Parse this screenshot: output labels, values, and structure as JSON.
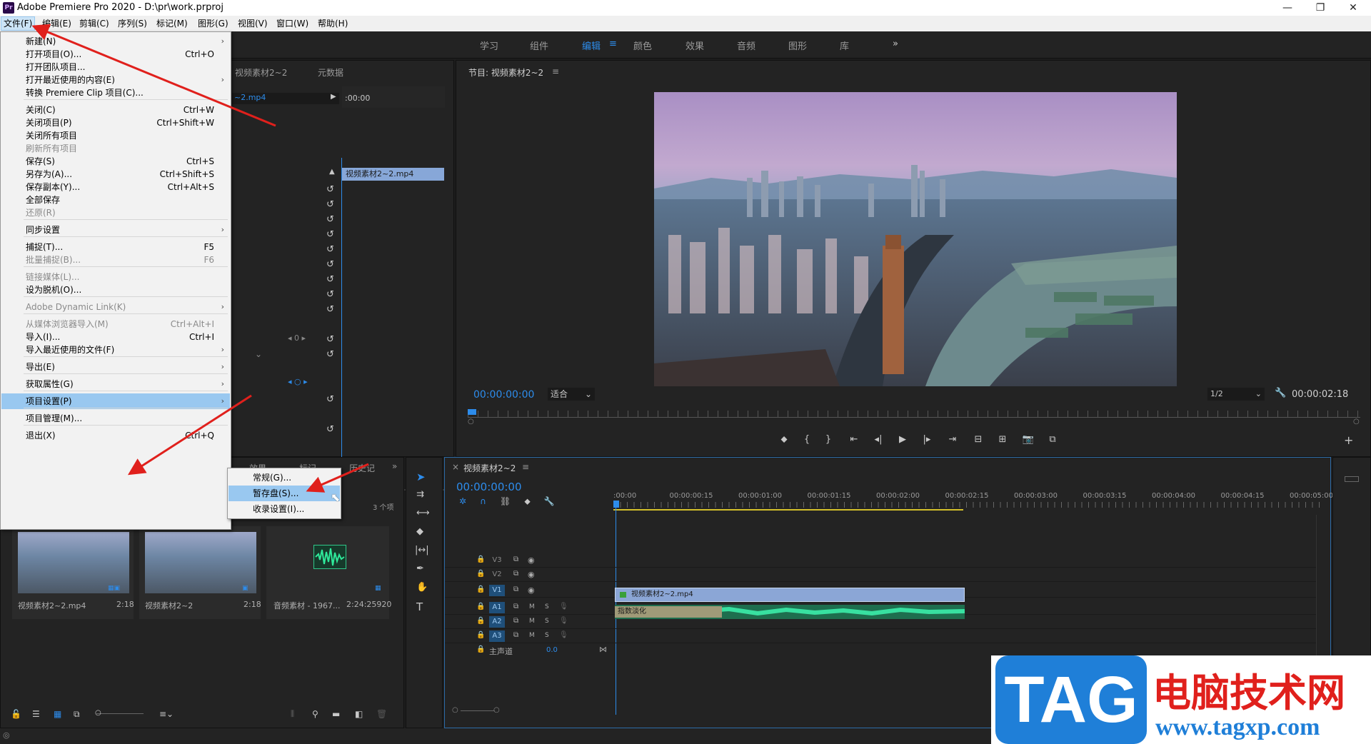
{
  "titlebar": {
    "title": "Adobe Premiere Pro 2020 - D:\\pr\\work.prproj",
    "logo": "Pr",
    "minimize": "—",
    "restore": "❐",
    "close": "✕"
  },
  "menubar": [
    "文件(F)",
    "编辑(E)",
    "剪辑(C)",
    "序列(S)",
    "标记(M)",
    "图形(G)",
    "视图(V)",
    "窗口(W)",
    "帮助(H)"
  ],
  "workspaces": {
    "items": [
      "学习",
      "组件",
      "编辑",
      "颜色",
      "效果",
      "音频",
      "图形",
      "库"
    ],
    "more": "»",
    "active_color": "#2d8ceb"
  },
  "source_panel": {
    "tabs": [
      "视频素材2~2",
      "元数据"
    ],
    "clip_tab": "~2.mp4",
    "ruler_time": ":00:00",
    "clip_label": "视频素材2~2.mp4",
    "kf_value": "0"
  },
  "program_monitor": {
    "title": "节目: 视频素材2~2",
    "menu": "≡",
    "timecode_left": "00:00:00:00",
    "fit": "适合",
    "resolution": "1/2",
    "timecode_right": "00:00:02:18",
    "plus": "+"
  },
  "project_panel": {
    "tabs": [
      "效果",
      "标记",
      "历史记"
    ],
    "count": "3 个项",
    "items": [
      {
        "name": "视频素材2~2.mp4",
        "duration": "2:18"
      },
      {
        "name": "视频素材2~2",
        "duration": "2:18"
      },
      {
        "name": "音频素材 - 1967...",
        "duration": "2:24:25920"
      }
    ]
  },
  "timeline": {
    "title": "视频素材2~2",
    "timecode": "00:00:00:00",
    "ruler": [
      ":00:00",
      "00:00:00:15",
      "00:00:01:00",
      "00:00:01:15",
      "00:00:02:00",
      "00:00:02:15",
      "00:00:03:00",
      "00:00:03:15",
      "00:00:04:00",
      "00:00:04:15",
      "00:00:05:00"
    ],
    "tracks": [
      "V3",
      "V2",
      "V1",
      "A1",
      "A2",
      "A3"
    ],
    "master": "主声道",
    "master_value": "0.0",
    "video_clip": "视频素材2~2.mp4",
    "audio_effect": "指数淡化",
    "m": "M",
    "s": "S"
  },
  "file_menu": {
    "items": [
      {
        "label": "新建(N)",
        "shortcut": "",
        "arrow": "›",
        "disabled": false
      },
      {
        "label": "打开项目(O)...",
        "shortcut": "Ctrl+O",
        "arrow": "",
        "disabled": false
      },
      {
        "label": "打开团队项目...",
        "shortcut": "",
        "arrow": "",
        "disabled": false
      },
      {
        "label": "打开最近使用的内容(E)",
        "shortcut": "",
        "arrow": "›",
        "disabled": false
      },
      {
        "label": "转换 Premiere Clip 项目(C)...",
        "shortcut": "",
        "arrow": "",
        "disabled": false
      },
      {
        "label": "关闭(C)",
        "shortcut": "Ctrl+W",
        "arrow": "",
        "disabled": false
      },
      {
        "label": "关闭项目(P)",
        "shortcut": "Ctrl+Shift+W",
        "arrow": "",
        "disabled": false
      },
      {
        "label": "关闭所有项目",
        "shortcut": "",
        "arrow": "",
        "disabled": false
      },
      {
        "label": "刷新所有项目",
        "shortcut": "",
        "arrow": "",
        "disabled": true
      },
      {
        "label": "保存(S)",
        "shortcut": "Ctrl+S",
        "arrow": "",
        "disabled": false
      },
      {
        "label": "另存为(A)...",
        "shortcut": "Ctrl+Shift+S",
        "arrow": "",
        "disabled": false
      },
      {
        "label": "保存副本(Y)...",
        "shortcut": "Ctrl+Alt+S",
        "arrow": "",
        "disabled": false
      },
      {
        "label": "全部保存",
        "shortcut": "",
        "arrow": "",
        "disabled": false
      },
      {
        "label": "还原(R)",
        "shortcut": "",
        "arrow": "",
        "disabled": true
      },
      {
        "label": "同步设置",
        "shortcut": "",
        "arrow": "›",
        "disabled": false
      },
      {
        "label": "捕捉(T)...",
        "shortcut": "F5",
        "arrow": "",
        "disabled": false
      },
      {
        "label": "批量捕捉(B)...",
        "shortcut": "F6",
        "arrow": "",
        "disabled": true
      },
      {
        "label": "链接媒体(L)...",
        "shortcut": "",
        "arrow": "",
        "disabled": true
      },
      {
        "label": "设为脱机(O)...",
        "shortcut": "",
        "arrow": "",
        "disabled": false
      },
      {
        "label": "Adobe Dynamic Link(K)",
        "shortcut": "",
        "arrow": "›",
        "disabled": true
      },
      {
        "label": "从媒体浏览器导入(M)",
        "shortcut": "Ctrl+Alt+I",
        "arrow": "",
        "disabled": true
      },
      {
        "label": "导入(I)...",
        "shortcut": "Ctrl+I",
        "arrow": "",
        "disabled": false
      },
      {
        "label": "导入最近使用的文件(F)",
        "shortcut": "",
        "arrow": "›",
        "disabled": false
      },
      {
        "label": "导出(E)",
        "shortcut": "",
        "arrow": "›",
        "disabled": false
      },
      {
        "label": "获取属性(G)",
        "shortcut": "",
        "arrow": "›",
        "disabled": false
      },
      {
        "label": "项目设置(P)",
        "shortcut": "",
        "arrow": "›",
        "disabled": false
      },
      {
        "label": "项目管理(M)...",
        "shortcut": "",
        "arrow": "",
        "disabled": false
      },
      {
        "label": "退出(X)",
        "shortcut": "Ctrl+Q",
        "arrow": "",
        "disabled": false
      }
    ]
  },
  "submenu": {
    "items": [
      "常规(G)...",
      "暂存盘(S)...",
      "收录设置(I)..."
    ]
  },
  "watermark": {
    "tag": "TAG",
    "cn": "电脑技术网",
    "url": "www.tagxp.com"
  }
}
